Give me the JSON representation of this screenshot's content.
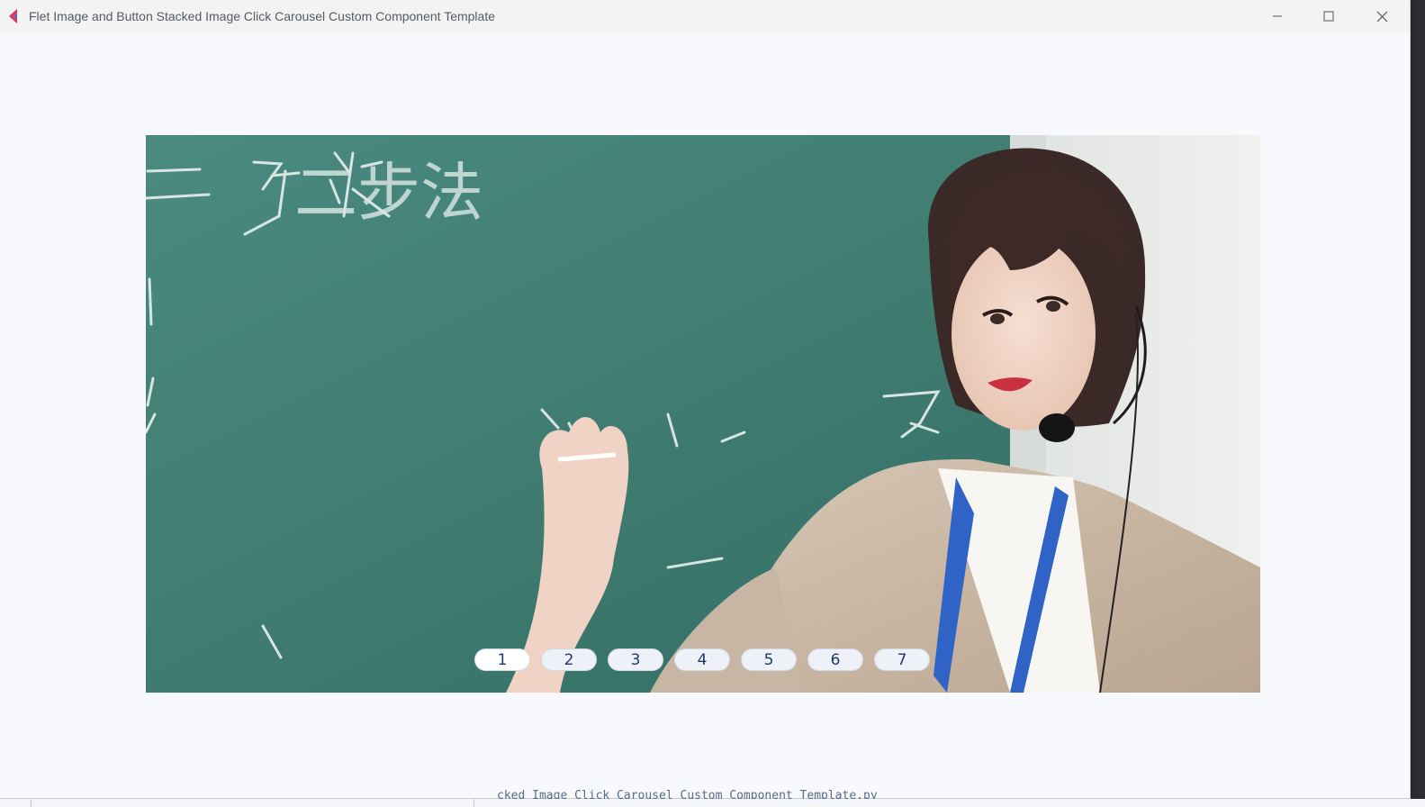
{
  "window": {
    "title": "Flet Image and Button Stacked Image Click Carousel Custom Component Template",
    "minimize_icon": "minimize-icon",
    "maximize_icon": "maximize-icon",
    "close_icon": "close-icon"
  },
  "carousel": {
    "current_page": 1,
    "buttons": [
      {
        "label": "1"
      },
      {
        "label": "2"
      },
      {
        "label": "3"
      },
      {
        "label": "4"
      },
      {
        "label": "5"
      },
      {
        "label": "6"
      },
      {
        "label": "7"
      }
    ],
    "chalk_text": "二步法"
  },
  "background": {
    "code_text": "cked Image Click Carousel Custom Component Template.py"
  },
  "colors": {
    "accent": "#20386a",
    "chalkboard": "#3f7d72",
    "window_bg": "#f8f9fd"
  }
}
